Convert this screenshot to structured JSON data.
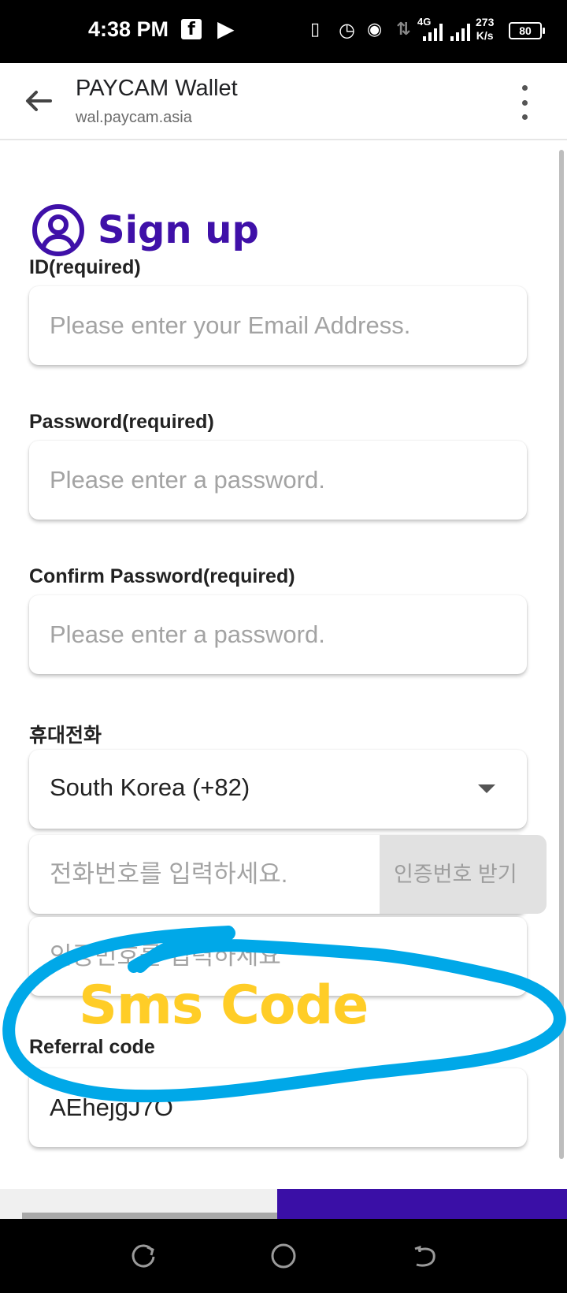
{
  "status_bar": {
    "time": "4:38 PM",
    "network_type": "4G",
    "speed_value": "273",
    "speed_unit": "K/s",
    "battery": "80",
    "icons": [
      "facebook-icon",
      "p-app-icon",
      "vibrate-icon",
      "alarm-icon",
      "hotspot-icon",
      "data-arrows-icon",
      "signal-icon",
      "battery-icon"
    ]
  },
  "browser": {
    "title": "PAYCAM Wallet",
    "url": "wal.paycam.asia"
  },
  "form": {
    "heading": "Sign up",
    "id_label": "ID(required)",
    "id_placeholder": "Please enter your Email Address.",
    "password_label": "Password(required)",
    "password_placeholder": "Please enter a password.",
    "confirm_label": "Confirm Password(required)",
    "confirm_placeholder": "Please enter a password.",
    "phone_label": "휴대전화",
    "country_value": "South Korea (+82)",
    "phone_placeholder": "전화번호를 입력하세요.",
    "sms_button": "인증번호 받기",
    "code_placeholder": "인증번호를 입력하세요",
    "referral_label": "Referral code",
    "referral_value": "AEhejgJ7O"
  },
  "annotation": {
    "text": "Sms Code",
    "text_color": "#ffcd27",
    "stroke_color": "#00a8e8"
  },
  "colors": {
    "accent": "#3f10a8",
    "bottom_button": "#3a0fa6"
  }
}
